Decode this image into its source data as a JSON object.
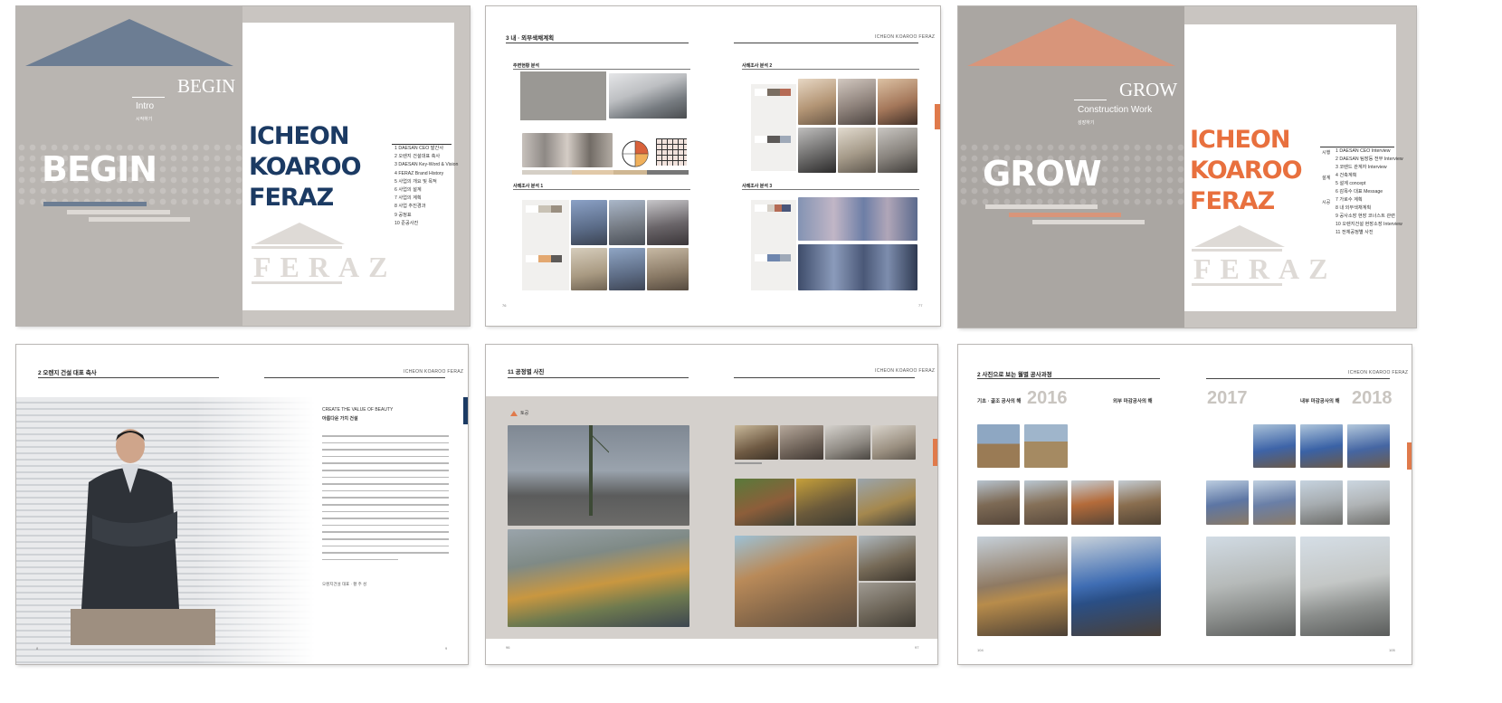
{
  "spread1": {
    "big_word": "BEGIN",
    "serif_word": "BEGIN",
    "section_title": "Intro",
    "section_sub": "시작하기",
    "title_lines": [
      "ICHEON",
      "KOAROO",
      "FERAZ"
    ],
    "logo": "FERAZ",
    "toc": [
      "1  DAESAN CEO 발간사",
      "2  오렌지 건설대표 축사",
      "3  DAESAN Key-Word & Vision",
      "4  FERAZ Brand History",
      "5  사업의 개요 및 목적",
      "6  사업의 설계",
      "7  사업의 계획",
      "8  사업 추진경과",
      "9  공정표",
      "10 준공사진"
    ]
  },
  "spread2": {
    "header_left": "3  내 · 외부색채계획",
    "header_right": "ICHEON KOAROO FERAZ",
    "section_a": "주변현황 분석",
    "section_b": "사례조사 분석 1",
    "section_c": "사례조사 분석 2",
    "section_d": "사례조사 분석 3",
    "page_left": "76",
    "page_right": "77",
    "colors": {
      "swatches": [
        "#c9c2b5",
        "#9a8f80",
        "#7a6e62",
        "#d9b38a",
        "#e3a870",
        "#5d5a58",
        "#6e86ae",
        "#9fa9b8",
        "#b56b55",
        "#d5cfc6"
      ]
    }
  },
  "spread3": {
    "big_word": "GROW",
    "serif_word": "GROW",
    "section_title": "Construction Work",
    "section_sub": "성장하기",
    "title_lines": [
      "ICHEON",
      "KOAROO",
      "FERAZ"
    ],
    "logo": "FERAZ",
    "toc_groups": [
      "시행",
      "설계",
      "시공"
    ],
    "toc": [
      "1  DAESAN CEO Interview",
      "2  DAESAN 팀장등 전무 Interview",
      "3  코렌드 관계자 Interview",
      "4  건축계획",
      "5  설계 concept",
      "6  감목수 대표 Message",
      "7  가로수 계획",
      "8  내 외부색채계획",
      "9  공사소장 현장 코너스트 관련",
      "10 오렌지건설 현장소장 Interview",
      "11 전체공정별 사진"
    ]
  },
  "spread4": {
    "header_left": "2  오렌지 건설 대표 축사",
    "header_right": "ICHEON KOAROO FERAZ",
    "quote_title": "CREATE THE VALUE OF BEAUTY",
    "quote_sub": "아름다운 가치 건설",
    "signature": "오렌지건설 대표  ·  황 주 성",
    "page_left": "8",
    "page_right": "9"
  },
  "spread5": {
    "header_left": "11  공정별 사진",
    "header_right": "ICHEON KOAROO FERAZ",
    "stage_label": "토공",
    "page_left": "96",
    "page_right": "97"
  },
  "spread6": {
    "header_left": "2  사진으로 보는 월별 공사과정",
    "header_right": "ICHEON KOAROO FERAZ",
    "label_a": "기초 · 골조 공사의 해",
    "year_a": "2016",
    "label_b": "외부 마감공사의 해",
    "year_b": "2017",
    "label_c": "내부 마감공사의 해",
    "year_c": "2018",
    "page_left": "104",
    "page_right": "105"
  }
}
